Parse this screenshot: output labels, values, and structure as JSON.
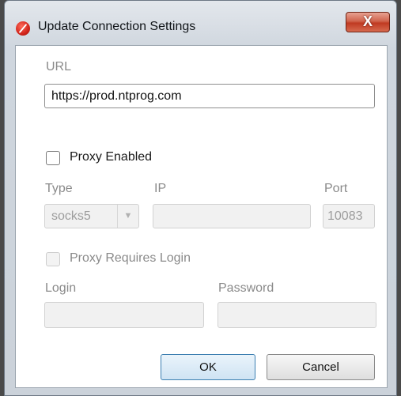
{
  "window": {
    "title": "Update Connection Settings",
    "close_label": "X"
  },
  "url": {
    "label": "URL",
    "value": "https://prod.ntprog.com"
  },
  "proxy": {
    "enabled_label": "Proxy Enabled",
    "enabled_checked": false,
    "type_label": "Type",
    "type_value": "socks5",
    "ip_label": "IP",
    "ip_value": "",
    "port_label": "Port",
    "port_value": "10083",
    "requires_login_label": "Proxy Requires Login",
    "requires_login_checked": false,
    "login_label": "Login",
    "login_value": "",
    "password_label": "Password",
    "password_value": ""
  },
  "buttons": {
    "ok": "OK",
    "cancel": "Cancel"
  }
}
